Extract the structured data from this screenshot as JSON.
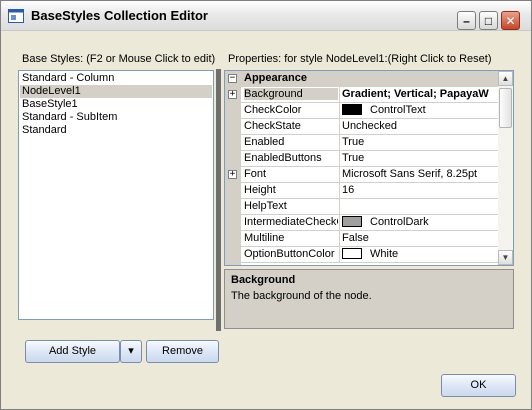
{
  "window": {
    "title": "BaseStyles Collection Editor",
    "minimize_glyph": "–",
    "maximize_glyph": "□",
    "close_glyph": "✕"
  },
  "base_styles": {
    "label": "Base Styles: (F2 or Mouse Click to edit)",
    "items": [
      {
        "label": "Standard - Column",
        "selected": false
      },
      {
        "label": "NodeLevel1",
        "selected": true
      },
      {
        "label": "BaseStyle1",
        "selected": false
      },
      {
        "label": "Standard - SubItem",
        "selected": false
      },
      {
        "label": "Standard",
        "selected": false
      }
    ]
  },
  "properties": {
    "label": "Properties: for style NodeLevel1:(Right Click to Reset)",
    "category": "Appearance",
    "rows": [
      {
        "name": "Background",
        "value": "Gradient; Vertical; PapayaW",
        "bold": true,
        "expandable": true,
        "selected": true
      },
      {
        "name": "CheckColor",
        "value": "ControlText",
        "swatch": "#000000"
      },
      {
        "name": "CheckState",
        "value": "Unchecked"
      },
      {
        "name": "Enabled",
        "value": "True"
      },
      {
        "name": "EnabledButtons",
        "value": "True"
      },
      {
        "name": "Font",
        "value": "Microsoft Sans Serif, 8.25pt",
        "expandable": true
      },
      {
        "name": "Height",
        "value": "16"
      },
      {
        "name": "HelpText",
        "value": ""
      },
      {
        "name": "IntermediateCheckC",
        "value": "ControlDark",
        "swatch": "#a0a0a0"
      },
      {
        "name": "Multiline",
        "value": "False"
      },
      {
        "name": "OptionButtonColor",
        "value": "White",
        "swatch": "#ffffff"
      }
    ]
  },
  "description": {
    "title": "Background",
    "text": "The background of the node."
  },
  "buttons": {
    "add_style": "Add Style",
    "dropdown_glyph": "▾",
    "remove": "Remove",
    "ok": "OK"
  },
  "colors": {
    "dialog_bg": "#ece9d8",
    "selection_bg": "#d4d0c8",
    "splitter": "#6f6f6f"
  }
}
